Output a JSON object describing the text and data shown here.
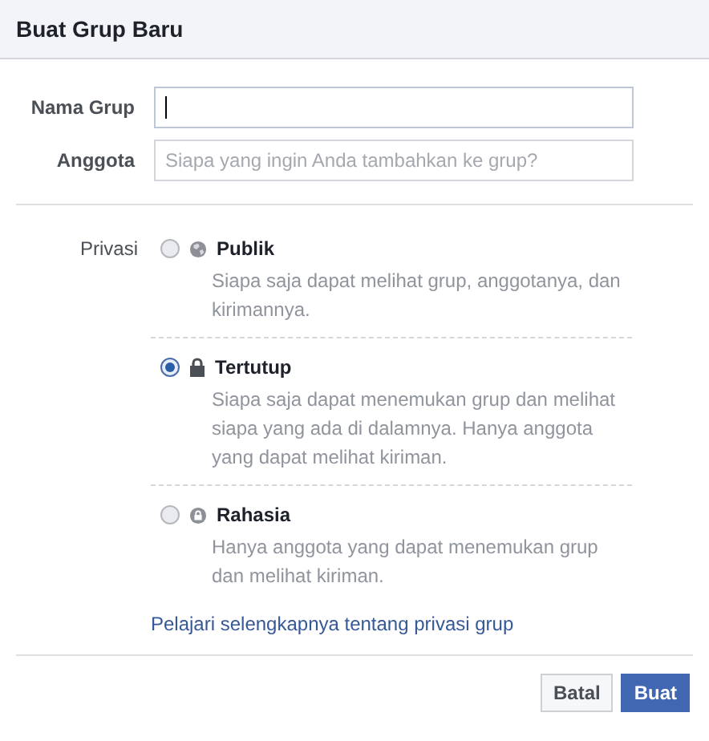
{
  "dialog": {
    "title": "Buat Grup Baru"
  },
  "fields": [
    {
      "label": "Nama Grup",
      "focused": true
    },
    {
      "label": "Anggota",
      "placeholder": "Siapa yang ingin Anda tambahkan ke grup?",
      "focused": false
    }
  ],
  "privacy": {
    "label": "Privasi",
    "options": [
      {
        "kind": "globe",
        "title": "Publik",
        "description": "Siapa saja dapat melihat grup, anggotanya, dan kirimannya.",
        "selected": false
      },
      {
        "kind": "lock",
        "title": "Tertutup",
        "description": "Siapa saja dapat menemukan grup dan melihat siapa yang ada di dalamnya. Hanya anggota yang dapat melihat kiriman.",
        "selected": true
      },
      {
        "kind": "secret",
        "title": "Rahasia",
        "description": "Hanya anggota yang dapat menemukan grup dan melihat kiriman.",
        "selected": false
      }
    ],
    "link": "Pelajari selengkapnya tentang privasi grup"
  },
  "buttons": [
    {
      "label": "Batal",
      "kind": "secondary"
    },
    {
      "label": "Buat",
      "kind": "primary"
    }
  ]
}
